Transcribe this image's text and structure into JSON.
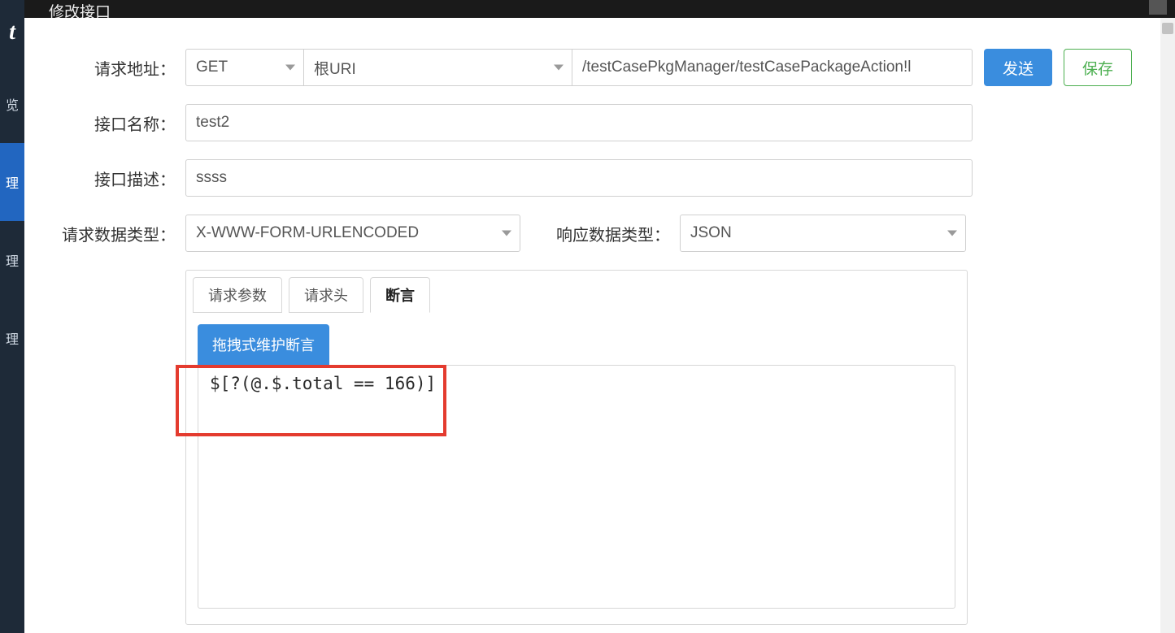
{
  "window": {
    "title": "修改接口"
  },
  "sidebar": {
    "logo_glyph": "t",
    "items": [
      {
        "label": "览",
        "active": false
      },
      {
        "label": "理",
        "active": true
      },
      {
        "label": "理",
        "active": false
      },
      {
        "label": "理",
        "active": false
      }
    ]
  },
  "form": {
    "url": {
      "label": "请求地址：",
      "method": "GET",
      "root_uri": "根URI",
      "path": "/testCasePkgManager/testCasePackageAction!l"
    },
    "name": {
      "label": "接口名称：",
      "value": "test2"
    },
    "desc": {
      "label": "接口描述：",
      "value": "ssss"
    },
    "req_type": {
      "label": "请求数据类型：",
      "value": "X-WWW-FORM-URLENCODED"
    },
    "resp_type": {
      "label": "响应数据类型：",
      "value": "JSON"
    }
  },
  "actions": {
    "send": "发送",
    "save": "保存"
  },
  "tabs": {
    "items": [
      {
        "label": "请求参数",
        "active": false
      },
      {
        "label": "请求头",
        "active": false
      },
      {
        "label": "断言",
        "active": true
      }
    ],
    "chip": "拖拽式维护断言",
    "assertion_text": "$[?(@.$.total == 166)]"
  }
}
